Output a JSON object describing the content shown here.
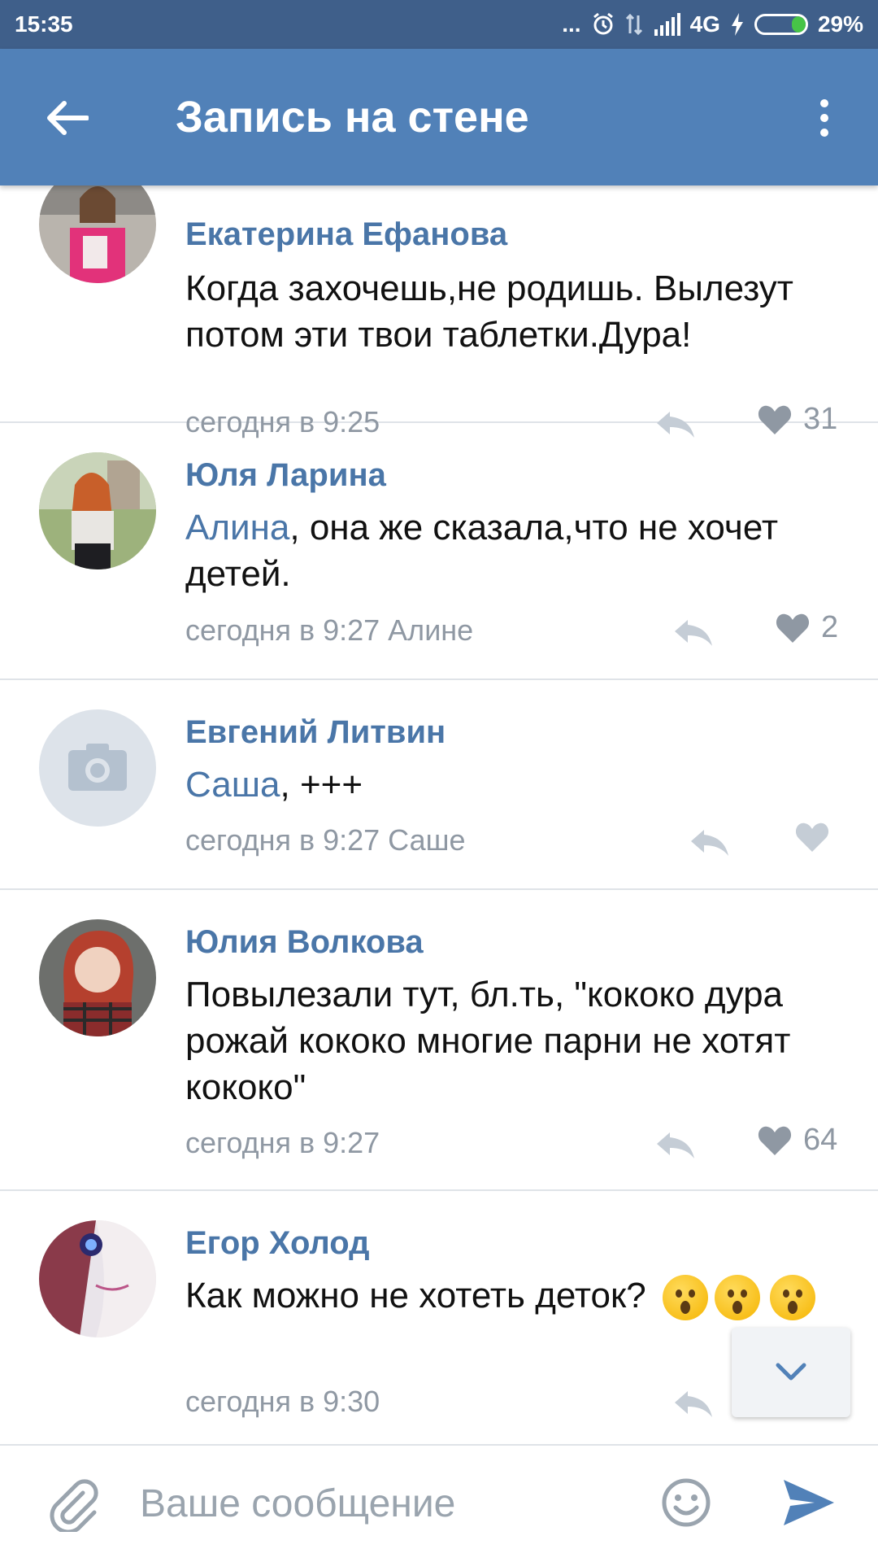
{
  "status_bar": {
    "time": "15:35",
    "dots": "...",
    "network": "4G",
    "battery": "29%",
    "battery_level": 0.29
  },
  "app_bar": {
    "title": "Запись на стене"
  },
  "comments": [
    {
      "author": "Екатерина Ефанова",
      "text": "Когда захочешь,не родишь. Вылезут потом эти твои таблетки.Дура!",
      "time": "сегодня в 9:25",
      "likes": "31"
    },
    {
      "author": "Юля Ларина",
      "mention": "Алина",
      "text": ", она же сказала,что не хочет детей.",
      "time": "сегодня в 9:27 Алине",
      "likes": "2"
    },
    {
      "author": "Евгений Литвин",
      "mention": "Саша",
      "text": ", +++",
      "time": "сегодня в 9:27 Саше",
      "likes": ""
    },
    {
      "author": "Юлия Волкова",
      "text": "Повылезали тут, бл.ть, \"кококо дура рожай кококо многие парни не хотят кококо\"",
      "time": "сегодня в 9:27",
      "likes": "64"
    },
    {
      "author": "Егор Холод",
      "text": "Как можно не хотеть деток?",
      "time": "сегодня в 9:30",
      "emojis": [
        "astonished-face",
        "astonished-face",
        "astonished-face"
      ]
    }
  ],
  "composer": {
    "placeholder": "Ваше сообщение"
  },
  "colors": {
    "status_bar": "#3f5f8a",
    "app_bar": "#5181b8",
    "link": "#4a76a8",
    "meta": "#8f98a3",
    "divider": "#dfe3e8"
  }
}
